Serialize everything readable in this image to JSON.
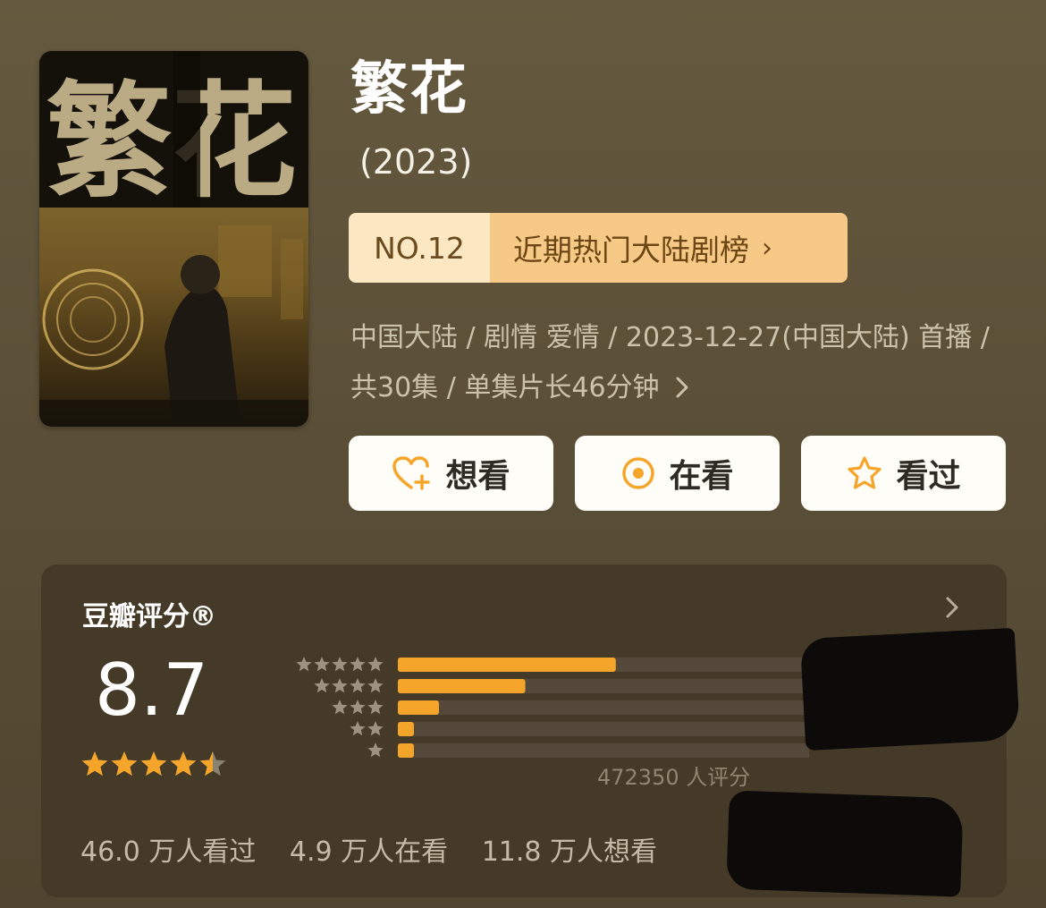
{
  "movie": {
    "title": "繁花",
    "year": "(2023)",
    "poster_title_art": "繁花"
  },
  "rank": {
    "number": "NO.12",
    "name": "近期热门大陆剧榜",
    "arrow": "›"
  },
  "meta": {
    "line": "中国大陆 / 剧情 爱情 / 2023-12-27(中国大陆) 首播 / 共30集 / 单集片长46分钟",
    "more_icon": "chevron-right-icon"
  },
  "actions": [
    {
      "label": "想看",
      "icon": "heart-plus-icon"
    },
    {
      "label": "在看",
      "icon": "target-circle-icon"
    },
    {
      "label": "看过",
      "icon": "star-outline-icon"
    }
  ],
  "rating": {
    "title": "豆瓣评分®",
    "score": "8.7",
    "stars": 4.5,
    "count_text": "472350 人评分",
    "distribution": [
      {
        "stars": 5,
        "fraction": 0.53
      },
      {
        "stars": 4,
        "fraction": 0.31
      },
      {
        "stars": 3,
        "fraction": 0.1
      },
      {
        "stars": 2,
        "fraction": 0.03
      },
      {
        "stars": 1,
        "fraction": 0.03
      }
    ],
    "stats": [
      "46.0 万人看过",
      "4.9 万人在看",
      "11.8 万人想看"
    ]
  },
  "colors": {
    "accent": "#f4a52a",
    "rank_badge_bg": "#fbe8c2",
    "rank_name_bg": "#f7c986",
    "card_bg": "#443a27"
  }
}
